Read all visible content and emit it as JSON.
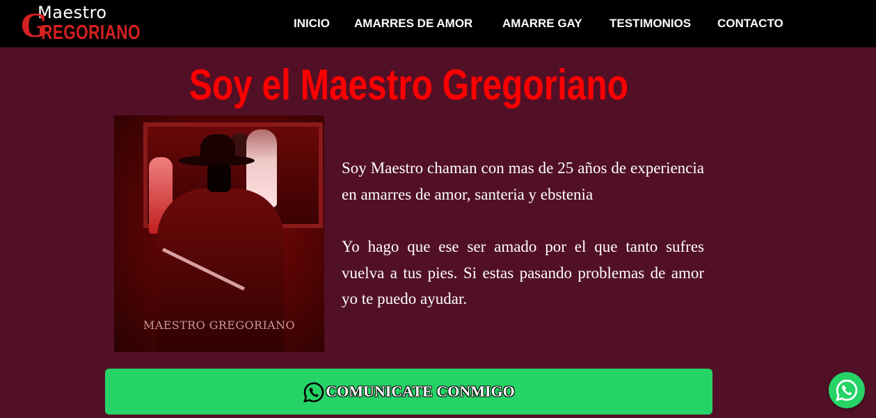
{
  "header": {
    "logo": {
      "top": "Maestro",
      "initial": "G",
      "rest": "REGORIANO"
    },
    "nav": [
      "INICIO",
      "AMARRES DE AMOR",
      "AMARRE GAY",
      "TESTIMONIOS",
      "CONTACTO"
    ]
  },
  "main": {
    "title": "Soy el Maestro Gregoriano",
    "photo_caption": "MAESTRO GREGORIANO",
    "paragraphs": [
      "Soy Maestro chaman con mas de 25 años de experiencia en amarres de amor, santeria y ebstenia",
      "Yo hago que ese ser amado por el que tanto sufres vuelva a tus pies. Si estas pasando problemas de amor yo te puedo ayudar."
    ],
    "cta_label": "COMUNICATE CONMIGO",
    "cta_icon": "whatsapp-icon"
  },
  "floating_button": {
    "icon": "whatsapp-icon"
  },
  "colors": {
    "background": "#521027",
    "header": "#000000",
    "title": "#ff0000",
    "logo_red": "#d42020",
    "cta": "#25d366"
  }
}
